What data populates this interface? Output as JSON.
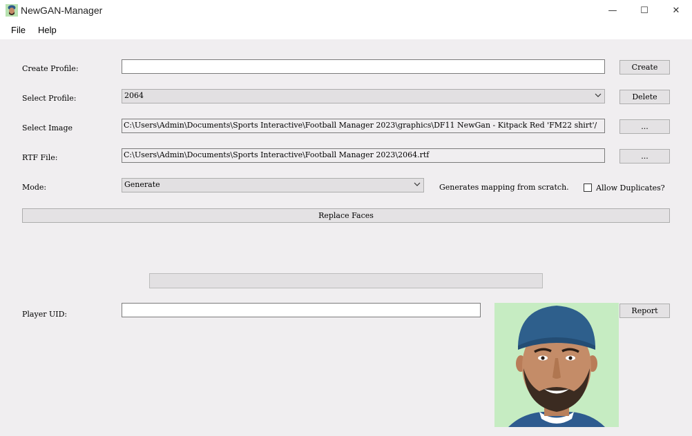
{
  "window": {
    "title": "NewGAN-Manager",
    "minimize_glyph": "—",
    "maximize_glyph": "☐",
    "close_glyph": "✕"
  },
  "menu": {
    "items": [
      {
        "label": "File"
      },
      {
        "label": "Help"
      }
    ]
  },
  "form": {
    "create_profile": {
      "label": "Create Profile:",
      "value": "",
      "button": "Create"
    },
    "select_profile": {
      "label": "Select Profile:",
      "value": "2064",
      "button": "Delete"
    },
    "select_image": {
      "label": "Select Image",
      "value": "C:\\Users\\Admin\\Documents\\Sports Interactive\\Football Manager 2023\\graphics\\DF11 NewGan - Kitpack Red 'FM22 shirt'/",
      "button": "..."
    },
    "rtf_file": {
      "label": "RTF File:",
      "value": "C:\\Users\\Admin\\Documents\\Sports Interactive\\Football Manager 2023\\2064.rtf",
      "button": "..."
    },
    "mode": {
      "label": "Mode:",
      "value": "Generate",
      "description": "Generates mapping from scratch.",
      "allow_duplicates_label": "Allow Duplicates?",
      "allow_duplicates_checked": false
    },
    "replace_faces_button": "Replace Faces",
    "progress_value": 0,
    "player_uid": {
      "label": "Player UID:",
      "value": "",
      "button": "Report"
    }
  },
  "colors": {
    "window_bg": "#f0eef0",
    "photo_bg": "#c6ecc2"
  },
  "icons": {
    "app": "player-face-icon",
    "dropdown": "chevron-down-icon"
  }
}
